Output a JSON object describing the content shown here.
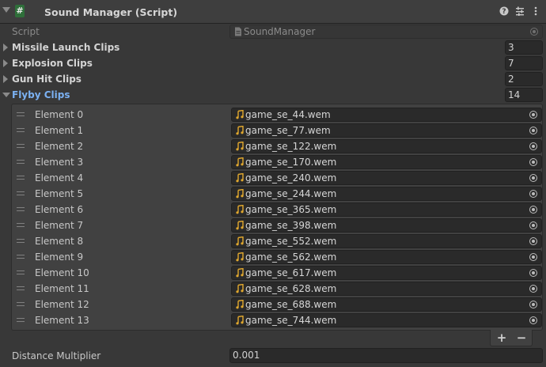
{
  "component": {
    "title": "Sound Manager (Script)",
    "icons": [
      "question-icon",
      "sliders-icon",
      "more-vert-icon"
    ]
  },
  "script": {
    "label": "Script",
    "value": "SoundManager"
  },
  "arrays": [
    {
      "label": "Missile Launch Clips",
      "size": "3"
    },
    {
      "label": "Explosion Clips",
      "size": "7"
    },
    {
      "label": "Gun Hit Clips",
      "size": "2"
    }
  ],
  "flyby": {
    "label": "Flyby Clips",
    "size": "14",
    "elements": [
      {
        "label": "Element 0",
        "value": "game_se_44.wem"
      },
      {
        "label": "Element 1",
        "value": "game_se_77.wem"
      },
      {
        "label": "Element 2",
        "value": "game_se_122.wem"
      },
      {
        "label": "Element 3",
        "value": "game_se_170.wem"
      },
      {
        "label": "Element 4",
        "value": "game_se_240.wem"
      },
      {
        "label": "Element 5",
        "value": "game_se_244.wem"
      },
      {
        "label": "Element 6",
        "value": "game_se_365.wem"
      },
      {
        "label": "Element 7",
        "value": "game_se_398.wem"
      },
      {
        "label": "Element 8",
        "value": "game_se_552.wem"
      },
      {
        "label": "Element 9",
        "value": "game_se_562.wem"
      },
      {
        "label": "Element 10",
        "value": "game_se_617.wem"
      },
      {
        "label": "Element 11",
        "value": "game_se_628.wem"
      },
      {
        "label": "Element 12",
        "value": "game_se_688.wem"
      },
      {
        "label": "Element 13",
        "value": "game_se_744.wem"
      }
    ],
    "add_label": "+",
    "remove_label": "−"
  },
  "distance": {
    "label": "Distance Multiplier",
    "value": "0.001"
  },
  "colors": {
    "background": "#383838",
    "field": "#2a2a2a",
    "accent": "#7bb1f2",
    "audio_icon": "#e0a72e",
    "script_icon": "#2f6f3a"
  }
}
